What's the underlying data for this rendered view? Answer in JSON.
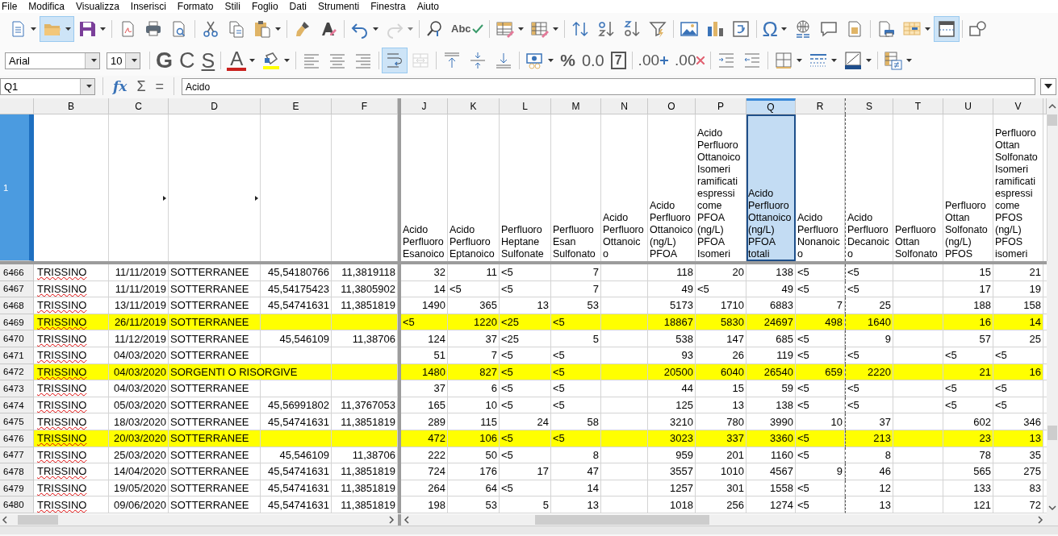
{
  "menu": [
    "File",
    "Modifica",
    "Visualizza",
    "Inserisci",
    "Formato",
    "Stili",
    "Foglio",
    "Dati",
    "Strumenti",
    "Finestra",
    "Aiuto"
  ],
  "toolbar_standard": [
    {
      "kind": "new-document",
      "dropdown": true,
      "selected": false,
      "disabled": false
    },
    {
      "kind": "open",
      "dropdown": true,
      "selected": true,
      "disabled": false
    },
    {
      "kind": "save",
      "dropdown": true,
      "selected": false,
      "disabled": false
    },
    {
      "kind": "separator"
    },
    {
      "kind": "export-pdf",
      "dropdown": false,
      "selected": false,
      "disabled": false
    },
    {
      "kind": "print",
      "dropdown": false,
      "selected": false,
      "disabled": false
    },
    {
      "kind": "print-preview",
      "dropdown": false,
      "selected": false,
      "disabled": false
    },
    {
      "kind": "separator"
    },
    {
      "kind": "cut",
      "dropdown": false,
      "selected": false,
      "disabled": false
    },
    {
      "kind": "copy",
      "dropdown": false,
      "selected": false,
      "disabled": false
    },
    {
      "kind": "paste",
      "dropdown": true,
      "selected": false,
      "disabled": false
    },
    {
      "kind": "separator"
    },
    {
      "kind": "clone-formatting",
      "dropdown": false,
      "selected": false,
      "disabled": false
    },
    {
      "kind": "clear-formatting",
      "dropdown": false,
      "selected": false,
      "disabled": false
    },
    {
      "kind": "separator"
    },
    {
      "kind": "undo",
      "dropdown": true,
      "selected": false,
      "disabled": false
    },
    {
      "kind": "redo",
      "dropdown": true,
      "selected": false,
      "disabled": true
    },
    {
      "kind": "separator"
    },
    {
      "kind": "find-replace",
      "dropdown": false,
      "selected": false,
      "disabled": false
    },
    {
      "kind": "spelling",
      "glyph": "Abc",
      "dropdown": false,
      "selected": false,
      "disabled": false
    },
    {
      "kind": "separator"
    },
    {
      "kind": "row",
      "dropdown": true,
      "selected": false,
      "disabled": false
    },
    {
      "kind": "column",
      "dropdown": true,
      "selected": false,
      "disabled": false
    },
    {
      "kind": "separator"
    },
    {
      "kind": "sort",
      "dropdown": false,
      "selected": false,
      "disabled": false
    },
    {
      "kind": "sort-ascending",
      "dropdown": false,
      "selected": false,
      "disabled": false
    },
    {
      "kind": "sort-descending",
      "dropdown": false,
      "selected": false,
      "disabled": false
    },
    {
      "kind": "autofilter",
      "dropdown": false,
      "selected": false,
      "disabled": false
    },
    {
      "kind": "separator"
    },
    {
      "kind": "image",
      "dropdown": false,
      "selected": false,
      "disabled": false
    },
    {
      "kind": "chart",
      "dropdown": false,
      "selected": false,
      "disabled": false
    },
    {
      "kind": "pivot-table",
      "dropdown": false,
      "selected": false,
      "disabled": false
    },
    {
      "kind": "separator"
    },
    {
      "kind": "special-character",
      "glyph": "Ω",
      "dropdown": true,
      "selected": false,
      "disabled": false
    },
    {
      "kind": "hyperlink",
      "dropdown": false,
      "selected": false,
      "disabled": false
    },
    {
      "kind": "comment",
      "dropdown": false,
      "selected": false,
      "disabled": false
    },
    {
      "kind": "header-footer",
      "dropdown": false,
      "selected": false,
      "disabled": false
    },
    {
      "kind": "separator"
    },
    {
      "kind": "print-area",
      "dropdown": false,
      "selected": false,
      "disabled": false
    },
    {
      "kind": "freeze",
      "dropdown": true,
      "selected": false,
      "disabled": false
    },
    {
      "kind": "split-window",
      "dropdown": false,
      "selected": true,
      "disabled": false
    },
    {
      "kind": "separator"
    },
    {
      "kind": "shapes",
      "dropdown": false,
      "selected": false,
      "disabled": false
    }
  ],
  "toolbar_formatting": [
    {
      "kind": "font-name",
      "value": "Arial"
    },
    {
      "kind": "font-size",
      "value": "10"
    },
    {
      "kind": "separator"
    },
    {
      "kind": "bold",
      "glyph": "G",
      "dropdown": false,
      "selected": false,
      "disabled": false
    },
    {
      "kind": "italic",
      "glyph": "C",
      "dropdown": false,
      "selected": false,
      "disabled": false
    },
    {
      "kind": "underline",
      "glyph": "S",
      "dropdown": false,
      "selected": false,
      "disabled": false
    },
    {
      "kind": "separator"
    },
    {
      "kind": "font-color",
      "glyph": "A",
      "dropdown": true,
      "selected": false,
      "disabled": false
    },
    {
      "kind": "highlight",
      "dropdown": true,
      "selected": false,
      "disabled": false
    },
    {
      "kind": "separator"
    },
    {
      "kind": "align-left",
      "dropdown": false,
      "selected": false,
      "disabled": false
    },
    {
      "kind": "align-center",
      "dropdown": false,
      "selected": false,
      "disabled": false
    },
    {
      "kind": "align-right",
      "dropdown": false,
      "selected": false,
      "disabled": false
    },
    {
      "kind": "separator"
    },
    {
      "kind": "wrap-text",
      "dropdown": false,
      "selected": true,
      "disabled": false
    },
    {
      "kind": "merge-cells",
      "dropdown": false,
      "selected": false,
      "disabled": true
    },
    {
      "kind": "separator"
    },
    {
      "kind": "align-top",
      "dropdown": false,
      "selected": false,
      "disabled": false
    },
    {
      "kind": "align-middle",
      "dropdown": false,
      "selected": false,
      "disabled": false
    },
    {
      "kind": "align-bottom",
      "dropdown": false,
      "selected": false,
      "disabled": false
    },
    {
      "kind": "separator"
    },
    {
      "kind": "currency",
      "dropdown": true,
      "selected": false,
      "disabled": false
    },
    {
      "kind": "percent",
      "glyph": "%",
      "dropdown": false,
      "selected": false,
      "disabled": false
    },
    {
      "kind": "number",
      "glyph": "0.0",
      "dropdown": false,
      "selected": false,
      "disabled": false
    },
    {
      "kind": "date",
      "glyph": "7",
      "dropdown": false,
      "selected": false,
      "disabled": false
    },
    {
      "kind": "separator"
    },
    {
      "kind": "add-decimal",
      "glyph": ".00",
      "dropdown": false,
      "selected": false,
      "disabled": false
    },
    {
      "kind": "delete-decimal",
      "glyph": ".00",
      "dropdown": false,
      "selected": false,
      "disabled": false
    },
    {
      "kind": "separator"
    },
    {
      "kind": "indent",
      "dropdown": false,
      "selected": false,
      "disabled": false
    },
    {
      "kind": "outdent",
      "dropdown": false,
      "selected": false,
      "disabled": false
    },
    {
      "kind": "separator"
    },
    {
      "kind": "borders",
      "dropdown": true,
      "selected": false,
      "disabled": false
    },
    {
      "kind": "border-style",
      "dropdown": true,
      "selected": false,
      "disabled": false
    },
    {
      "kind": "border-color",
      "dropdown": true,
      "selected": false,
      "disabled": false
    },
    {
      "kind": "separator"
    },
    {
      "kind": "conditional",
      "dropdown": true,
      "selected": false,
      "disabled": false
    }
  ],
  "formula_bar": {
    "cell_reference": "Q1",
    "function_glyph": "fx",
    "sum_glyph": "Σ",
    "equals_glyph": "=",
    "content": "Acido"
  },
  "sheet": {
    "header_row": {
      "number": "1",
      "selected": true
    },
    "columns": [
      {
        "letter": "B",
        "selected": false,
        "overflow": false,
        "misspelled": true,
        "page_break": false
      },
      {
        "letter": "C",
        "selected": false,
        "overflow": true,
        "misspelled": false,
        "page_break": false
      },
      {
        "letter": "D",
        "selected": false,
        "overflow": true,
        "misspelled": false,
        "page_break": false
      },
      {
        "letter": "E",
        "selected": false,
        "overflow": false,
        "misspelled": false,
        "page_break": false
      },
      {
        "letter": "F",
        "selected": false,
        "overflow": false,
        "misspelled": false,
        "page_break": false
      },
      {
        "letter": "J",
        "selected": false,
        "overflow": false,
        "misspelled": false,
        "page_break": false,
        "header": "Acido Perfluoro Esanoico"
      },
      {
        "letter": "K",
        "selected": false,
        "overflow": false,
        "misspelled": false,
        "page_break": false,
        "header": "Acido Perfluoro Eptanoico"
      },
      {
        "letter": "L",
        "selected": false,
        "overflow": false,
        "misspelled": false,
        "page_break": false,
        "header": "Perfluoro Heptane Sulfonate"
      },
      {
        "letter": "M",
        "selected": false,
        "overflow": false,
        "misspelled": false,
        "page_break": false,
        "header": "Perfluoro Esan Sulfonato"
      },
      {
        "letter": "N",
        "selected": false,
        "overflow": false,
        "page_break": false,
        "header": "Acido Perfluoro Ottanoico"
      },
      {
        "letter": "O",
        "selected": false,
        "overflow": false,
        "misspelled": false,
        "page_break": false,
        "header": "Acido Perfluoro Ottanoico (ng/L) PFOA"
      },
      {
        "letter": "P",
        "selected": false,
        "overflow": false,
        "misspelled": false,
        "page_break": false,
        "header": "Acido Perfluoro Ottanoico Isomeri ramificati espressi come PFOA (ng/L) PFOA Isomeri"
      },
      {
        "letter": "Q",
        "selected": true,
        "overflow": false,
        "misspelled": false,
        "page_break": false,
        "header": "Acido Perfluoro Ottanoico (ng/L) PFOA totali"
      },
      {
        "letter": "R",
        "selected": false,
        "overflow": false,
        "misspelled": false,
        "page_break": false,
        "header": "Acido Perfluoro Nonanoico"
      },
      {
        "letter": "S",
        "selected": false,
        "overflow": false,
        "misspelled": false,
        "page_break": true,
        "header": "Acido Perfluoro Decanoico"
      },
      {
        "letter": "T",
        "selected": false,
        "overflow": false,
        "page_break": false,
        "header": "Perfluoro Ottan Solfonato"
      },
      {
        "letter": "U",
        "selected": false,
        "overflow": false,
        "misspelled": false,
        "page_break": false,
        "header": "Perfluoro Ottan Solfonato (ng/L) PFOS"
      },
      {
        "letter": "V",
        "selected": false,
        "overflow": false,
        "misspelled": false,
        "page_break": false,
        "header": "Perfluoro Ottan Solfonato Isomeri ramificati espressi come PFOS (ng/L) PFOS isomeri"
      }
    ],
    "rows": [
      {
        "number": "6466",
        "highlighted": false,
        "B": "TRISSINO",
        "C": "11/11/2019",
        "D": "SOTTERRANEE",
        "E": "45,54180766",
        "F": "11,3819118",
        "J": "32",
        "K": "11",
        "L": "<5",
        "M": "7",
        "O": "118",
        "P": "20",
        "Q": "138",
        "R": "<5",
        "S": "<5",
        "U": "15",
        "V": "21"
      },
      {
        "number": "6467",
        "highlighted": false,
        "B": "TRISSINO",
        "C": "11/11/2019",
        "D": "SOTTERRANEE",
        "E": "45,54175423",
        "F": "11,3805902",
        "J": "14",
        "K": "<5",
        "L": "<5",
        "M": "7",
        "O": "49",
        "P": "<5",
        "Q": "49",
        "R": "<5",
        "S": "<5",
        "U": "17",
        "V": "19"
      },
      {
        "number": "6468",
        "highlighted": false,
        "B": "TRISSINO",
        "C": "13/11/2019",
        "D": "SOTTERRANEE",
        "E": "45,54741631",
        "F": "11,3851819",
        "J": "1490",
        "K": "365",
        "L": "13",
        "M": "53",
        "O": "5173",
        "P": "1710",
        "Q": "6883",
        "R": "7",
        "S": "25",
        "U": "188",
        "V": "158"
      },
      {
        "number": "6469",
        "highlighted": true,
        "B": "TRISSINO",
        "C": "26/11/2019",
        "D": "SOTTERRANEE",
        "J": "<5",
        "K": "1220",
        "L": "<25",
        "M": "<5",
        "O": "18867",
        "P": "5830",
        "Q": "24697",
        "R": "498",
        "S": "1640",
        "U": "16",
        "V": "14"
      },
      {
        "number": "6470",
        "highlighted": false,
        "B": "TRISSINO",
        "C": "11/12/2019",
        "D": "SOTTERRANEE",
        "E": "45,546109",
        "F": "11,38706",
        "J": "124",
        "K": "37",
        "L": "<25",
        "M": "5",
        "O": "538",
        "P": "147",
        "Q": "685",
        "R": "<5",
        "S": "9",
        "U": "57",
        "V": "25"
      },
      {
        "number": "6471",
        "highlighted": false,
        "B": "TRISSINO",
        "C": "04/03/2020",
        "D": "SOTTERRANEE",
        "J": "51",
        "K": "7",
        "L": "<5",
        "M": "<5",
        "O": "93",
        "P": "26",
        "Q": "119",
        "R": "<5",
        "S": "<5",
        "U": "<5",
        "V": "<5"
      },
      {
        "number": "6472",
        "highlighted": true,
        "B": "TRISSINO",
        "C": "04/03/2020",
        "D": "SORGENTI O RISORGIVE",
        "J": "1480",
        "K": "827",
        "L": "<5",
        "M": "<5",
        "O": "20500",
        "P": "6040",
        "Q": "26540",
        "R": "659",
        "S": "2220",
        "U": "21",
        "V": "16"
      },
      {
        "number": "6473",
        "highlighted": false,
        "B": "TRISSINO",
        "C": "04/03/2020",
        "D": "SOTTERRANEE",
        "J": "37",
        "K": "6",
        "L": "<5",
        "M": "<5",
        "O": "44",
        "P": "15",
        "Q": "59",
        "R": "<5",
        "S": "<5",
        "U": "<5",
        "V": "<5"
      },
      {
        "number": "6474",
        "highlighted": false,
        "B": "TRISSINO",
        "C": "05/03/2020",
        "D": "SOTTERRANEE",
        "E": "45,56991802",
        "F": "11,3767053",
        "J": "165",
        "K": "10",
        "L": "<5",
        "M": "<5",
        "O": "125",
        "P": "13",
        "Q": "138",
        "R": "<5",
        "S": "<5",
        "U": "<5",
        "V": "<5"
      },
      {
        "number": "6475",
        "highlighted": false,
        "B": "TRISSINO",
        "C": "18/03/2020",
        "D": "SOTTERRANEE",
        "E": "45,54741631",
        "F": "11,3851819",
        "J": "289",
        "K": "115",
        "L": "24",
        "M": "58",
        "O": "3210",
        "P": "780",
        "Q": "3990",
        "R": "10",
        "S": "37",
        "U": "602",
        "V": "346"
      },
      {
        "number": "6476",
        "highlighted": true,
        "B": "TRISSINO",
        "C": "20/03/2020",
        "D": "SOTTERRANEE",
        "J": "472",
        "K": "106",
        "L": "<5",
        "M": "<5",
        "O": "3023",
        "P": "337",
        "Q": "3360",
        "R": "<5",
        "S": "213",
        "U": "23",
        "V": "13"
      },
      {
        "number": "6477",
        "highlighted": false,
        "B": "TRISSINO",
        "C": "25/03/2020",
        "D": "SOTTERRANEE",
        "E": "45,546109",
        "F": "11,38706",
        "J": "222",
        "K": "50",
        "L": "<5",
        "M": "8",
        "O": "959",
        "P": "201",
        "Q": "1160",
        "R": "<5",
        "S": "8",
        "U": "78",
        "V": "35"
      },
      {
        "number": "6478",
        "highlighted": false,
        "B": "TRISSINO",
        "C": "14/04/2020",
        "D": "SOTTERRANEE",
        "E": "45,54741631",
        "F": "11,3851819",
        "J": "724",
        "K": "176",
        "L": "17",
        "M": "47",
        "O": "3557",
        "P": "1010",
        "Q": "4567",
        "R": "9",
        "S": "46",
        "U": "565",
        "V": "275"
      },
      {
        "number": "6479",
        "highlighted": false,
        "B": "TRISSINO",
        "C": "19/05/2020",
        "D": "SOTTERRANEE",
        "E": "45,54741631",
        "F": "11,3851819",
        "J": "264",
        "K": "64",
        "L": "<5",
        "M": "14",
        "O": "1257",
        "P": "301",
        "Q": "1558",
        "R": "<5",
        "S": "12",
        "U": "133",
        "V": "83"
      },
      {
        "number": "6480",
        "highlighted": false,
        "B": "TRISSINO",
        "C": "09/06/2020",
        "D": "SOTTERRANEE",
        "E": "45,54741631",
        "F": "11,3851819",
        "J": "198",
        "K": "53",
        "L": "5",
        "M": "13",
        "O": "1018",
        "P": "256",
        "Q": "1274",
        "R": "<5",
        "S": "13",
        "U": "121",
        "V": "72"
      }
    ]
  }
}
